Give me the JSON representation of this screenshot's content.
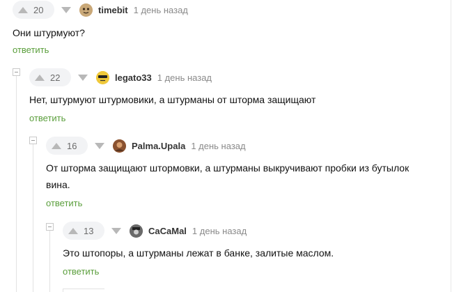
{
  "reply_label": "ответить",
  "comments": [
    {
      "rating": "20",
      "username": "timebit",
      "time": "1 день назад",
      "text": "Они штурмуют?",
      "avatar_color": "#c7a77e"
    },
    {
      "rating": "22",
      "username": "legato33",
      "time": "1 день назад",
      "text": "Нет, штурмуют штурмовики, а штурманы от шторма защищают",
      "avatar_color": "#e9c43a"
    },
    {
      "rating": "16",
      "username": "Palma.Upala",
      "time": "1 день назад",
      "text_line1": "От шторма защищают штормовки, а штурманы выкручивают пробки из бутылок",
      "text_line2": "вина.",
      "avatar_color": "#a0623a"
    },
    {
      "rating": "13",
      "username": "CaCaMal",
      "time": "1 день назад",
      "text": "Это штопоры, а штурманы лежат в банке, залитые маслом.",
      "avatar_color": "#555555"
    }
  ],
  "colors": {
    "accent_green": "#5a9e3b",
    "meta_gray": "#8a8a8a",
    "rate_bg": "#f2f3f5"
  }
}
